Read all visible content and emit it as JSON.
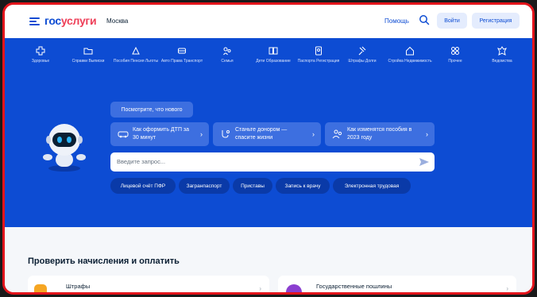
{
  "header": {
    "logo_part1": "гос",
    "logo_part2": "услуги",
    "city": "Москва",
    "help": "Помощь",
    "login": "Войти",
    "register": "Регистрация"
  },
  "categories": [
    {
      "label": "Здоровье",
      "icon": "health-icon"
    },
    {
      "label": "Справки Выписки",
      "icon": "folder-icon"
    },
    {
      "label": "Пособия Пенсия Льготы",
      "icon": "benefits-icon"
    },
    {
      "label": "Авто Права Транспорт",
      "icon": "car-icon"
    },
    {
      "label": "Семья",
      "icon": "family-icon"
    },
    {
      "label": "Дети Образование",
      "icon": "book-icon"
    },
    {
      "label": "Паспорта Регистрация",
      "icon": "passport-icon"
    },
    {
      "label": "Штрафы Долги",
      "icon": "gavel-icon"
    },
    {
      "label": "Стройка Недвижимость",
      "icon": "house-icon"
    },
    {
      "label": "Прочее",
      "icon": "grid-icon"
    },
    {
      "label": "Ведомствa",
      "icon": "emblem-icon"
    }
  ],
  "hero": {
    "news_button": "Посмотрите, что нового",
    "promo1": "Как оформить ДТП за 30 минут",
    "promo2": "Станьте донором — спасите жизни",
    "promo3": "Как изменятся пособия в 2023 году",
    "search_placeholder": "Введите запрос...",
    "chips": [
      "Лицевой счёт ПФР",
      "Загранпаспорт",
      "Приставы",
      "Запись к врачу",
      "Электронная трудовая"
    ]
  },
  "lower": {
    "title": "Проверить начисления и оплатить",
    "card1": "Штрафы",
    "card2": "Государственные пошлины"
  },
  "colors": {
    "brand_blue": "#0d4cd3",
    "brand_red": "#ee3f58",
    "frame_red": "#e3141b"
  }
}
